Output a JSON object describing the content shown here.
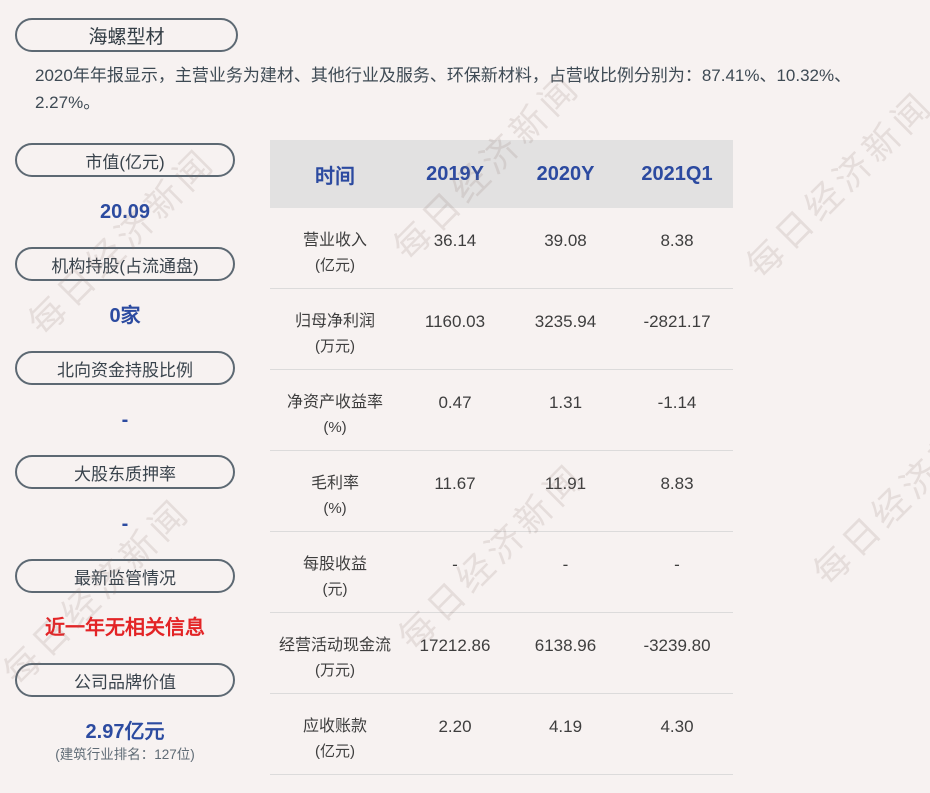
{
  "page": {
    "stock_name": "海螺型材",
    "description": "2020年年报显示，主营业务为建材、其他行业及服务、环保新材料，占营收比例分别为：87.41%、10.32%、2.27%。",
    "watermark_text": "每日经济新闻"
  },
  "colors": {
    "background": "#f7f2f1",
    "accent_blue": "#2c4ba0",
    "alert_red": "#e32426",
    "pill_border": "#5d6973",
    "table_header_bg": "#e2e1e1",
    "body_text": "#3e3e3e"
  },
  "sidebar": {
    "items": [
      {
        "label": "市值(亿元)",
        "value": "20.09"
      },
      {
        "label": "机构持股(占流通盘)",
        "value": "0家"
      },
      {
        "label": "北向资金持股比例",
        "value": "-"
      },
      {
        "label": "大股东质押率",
        "value": "-"
      },
      {
        "label": "最新监管情况",
        "value": "近一年无相关信息"
      },
      {
        "label": "公司品牌价值",
        "value": "2.97亿元",
        "note": "(建筑行业排名：127位)"
      }
    ]
  },
  "table": {
    "columns": [
      "时间",
      "2019Y",
      "2020Y",
      "2021Q1"
    ],
    "rows": [
      {
        "label": "营业收入",
        "unit": "(亿元)",
        "values": [
          "36.14",
          "39.08",
          "8.38"
        ]
      },
      {
        "label": "归母净利润",
        "unit": "(万元)",
        "values": [
          "1160.03",
          "3235.94",
          "-2821.17"
        ]
      },
      {
        "label": "净资产收益率",
        "unit": "(%)",
        "values": [
          "0.47",
          "1.31",
          "-1.14"
        ]
      },
      {
        "label": "毛利率",
        "unit": "(%)",
        "values": [
          "11.67",
          "11.91",
          "8.83"
        ]
      },
      {
        "label": "每股收益",
        "unit": "(元)",
        "values": [
          "-",
          "-",
          "-"
        ]
      },
      {
        "label": "经营活动现金流",
        "unit": "(万元)",
        "values": [
          "17212.86",
          "6138.96",
          "-3239.80"
        ]
      },
      {
        "label": "应收账款",
        "unit": "(亿元)",
        "values": [
          "2.20",
          "4.19",
          "4.30"
        ]
      }
    ]
  }
}
